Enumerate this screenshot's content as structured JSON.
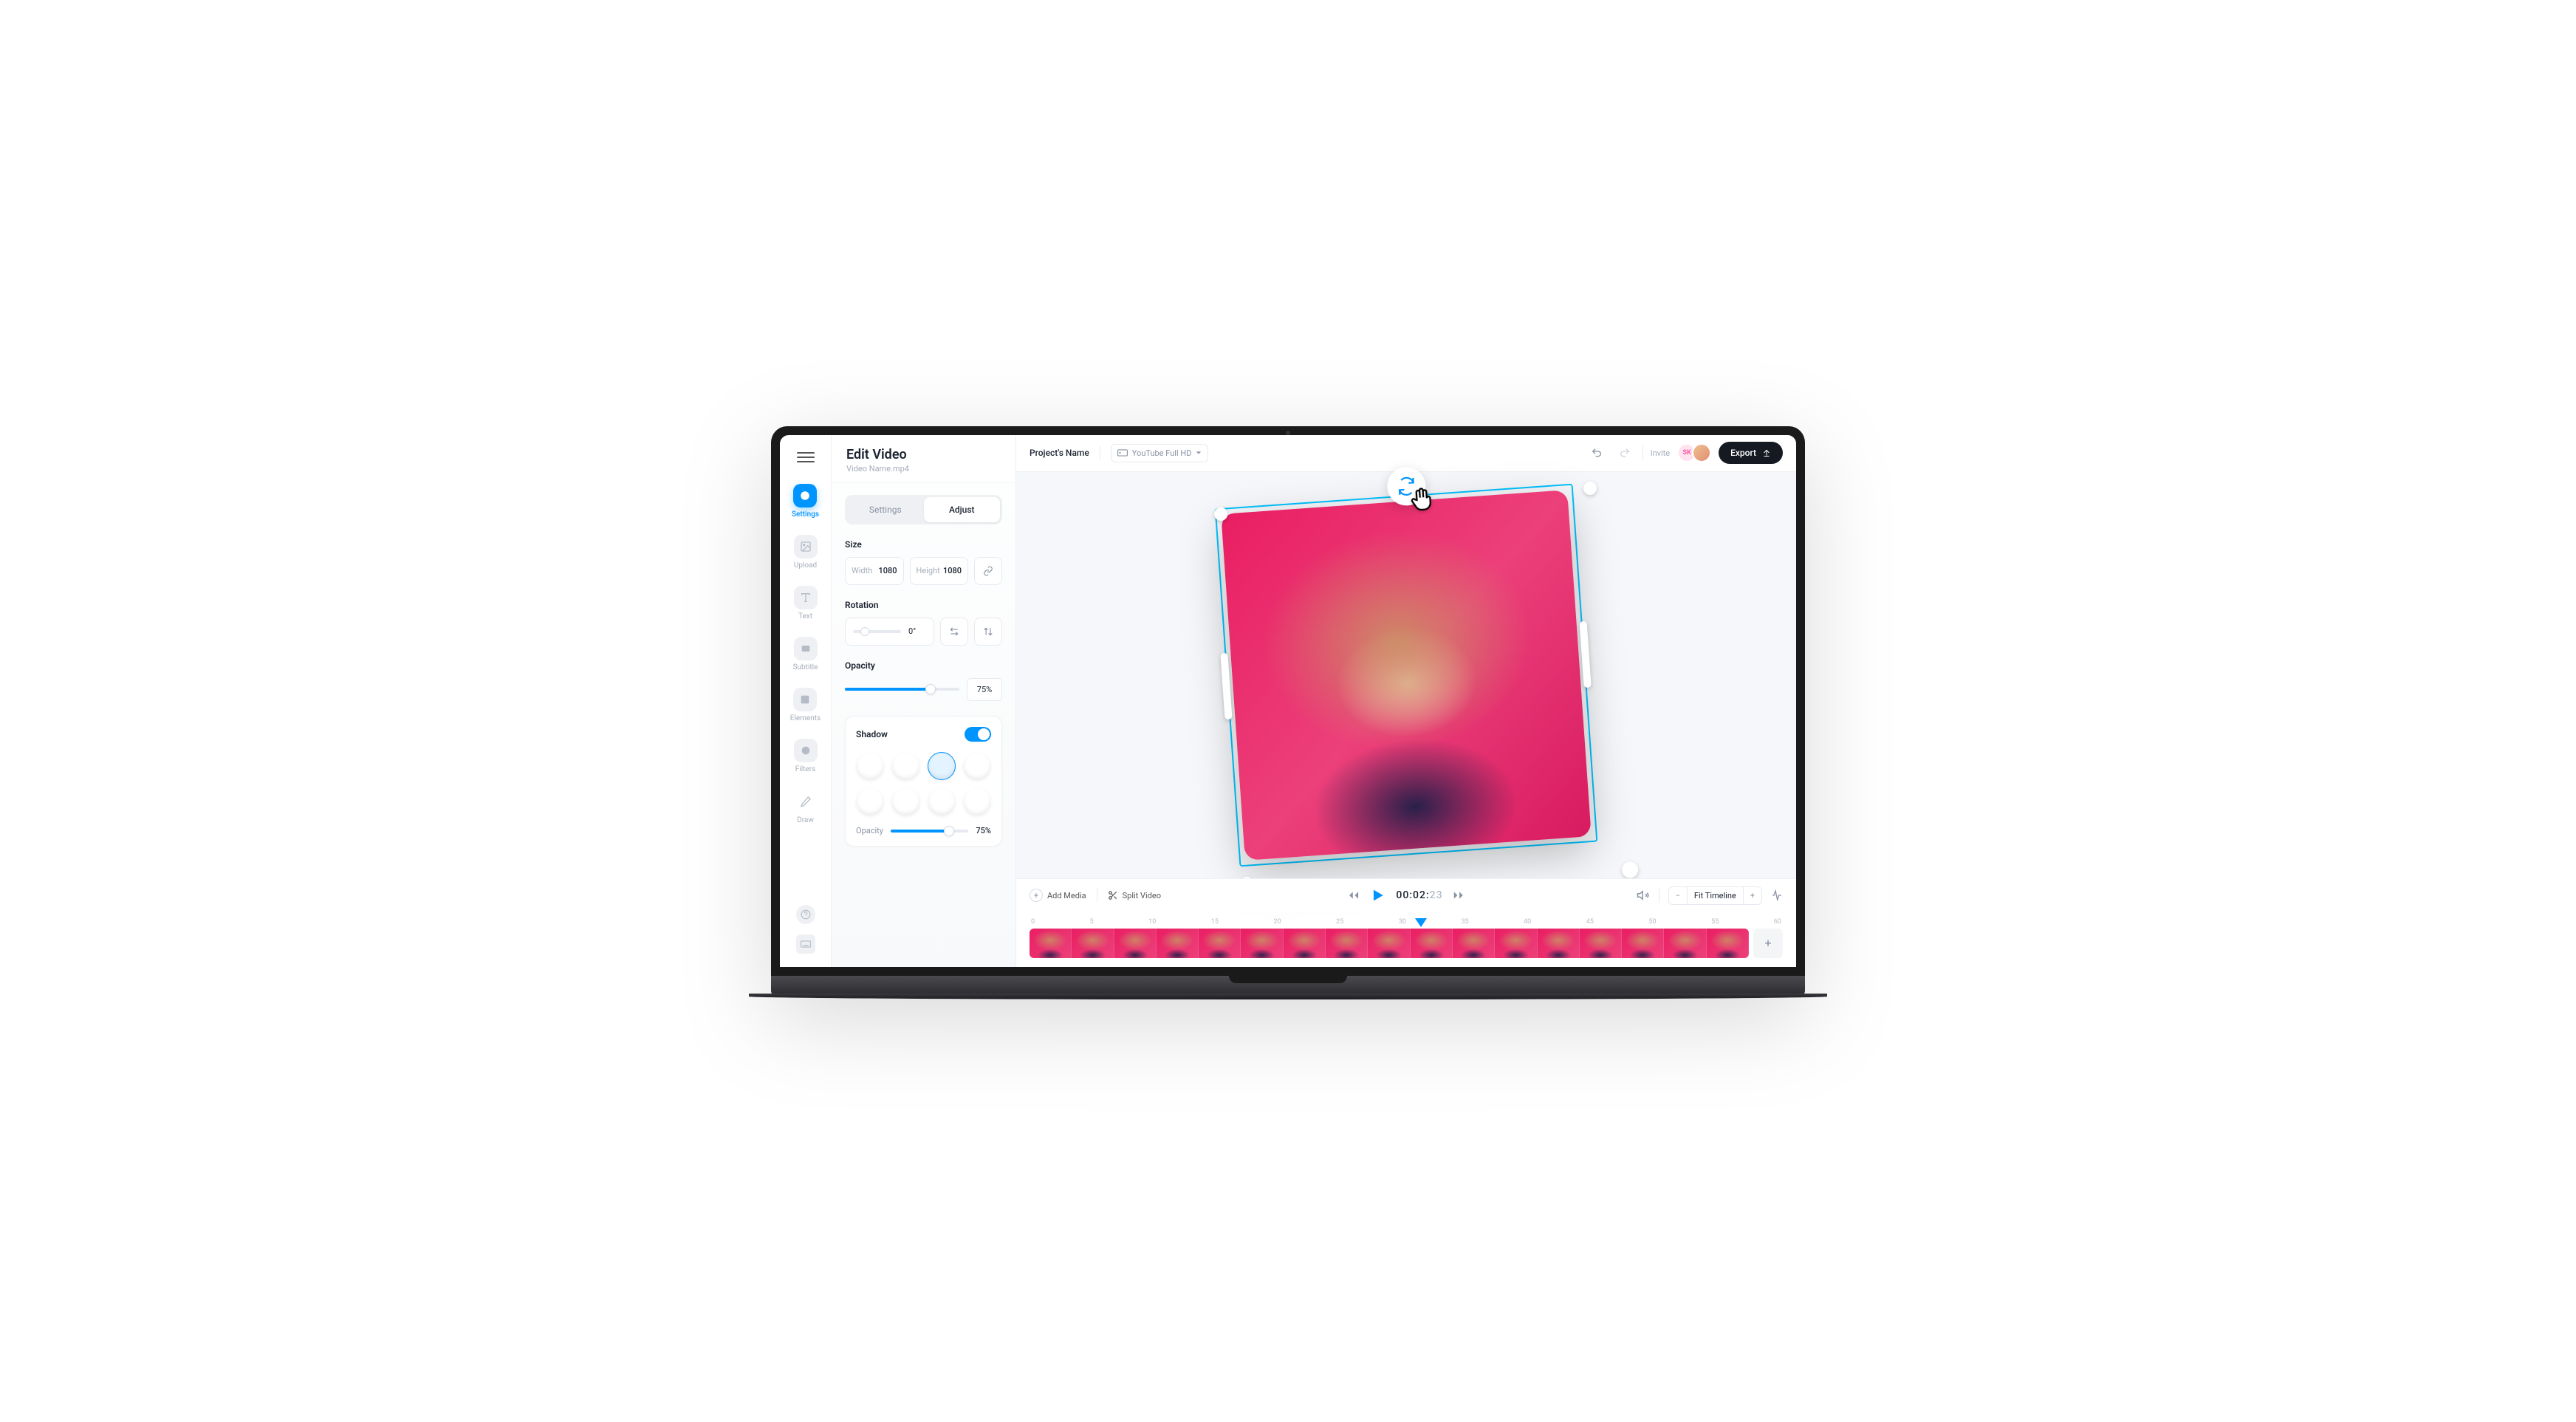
{
  "panel": {
    "title": "Edit Video",
    "subtitle": "Video Name.mp4",
    "tabs": {
      "settings": "Settings",
      "adjust": "Adjust"
    },
    "size": {
      "label": "Size",
      "width_label": "Width",
      "width_value": "1080",
      "height_label": "Height",
      "height_value": "1080"
    },
    "rotation": {
      "label": "Rotation",
      "value": "0°"
    },
    "opacity": {
      "label": "Opacity",
      "value": "75%"
    },
    "shadow": {
      "label": "Shadow",
      "opacity_label": "Opacity",
      "opacity_value": "75%"
    }
  },
  "sidebar": {
    "items": [
      {
        "label": "Settings"
      },
      {
        "label": "Upload"
      },
      {
        "label": "Text"
      },
      {
        "label": "Subtitle"
      },
      {
        "label": "Elements"
      },
      {
        "label": "Filters"
      },
      {
        "label": "Draw"
      }
    ]
  },
  "topbar": {
    "project": "Project's Name",
    "preset": "YouTube Full HD",
    "invite": "Invite",
    "avatar_initials": "SK",
    "export": "Export"
  },
  "controls": {
    "add_media": "Add Media",
    "split_video": "Split Video",
    "timecode_active": "00:02:",
    "timecode_rest": "23",
    "fit_timeline": "Fit Timeline"
  },
  "ruler": [
    "0",
    "5",
    "10",
    "15",
    "20",
    "25",
    "30",
    "35",
    "40",
    "45",
    "50",
    "55",
    "60"
  ]
}
